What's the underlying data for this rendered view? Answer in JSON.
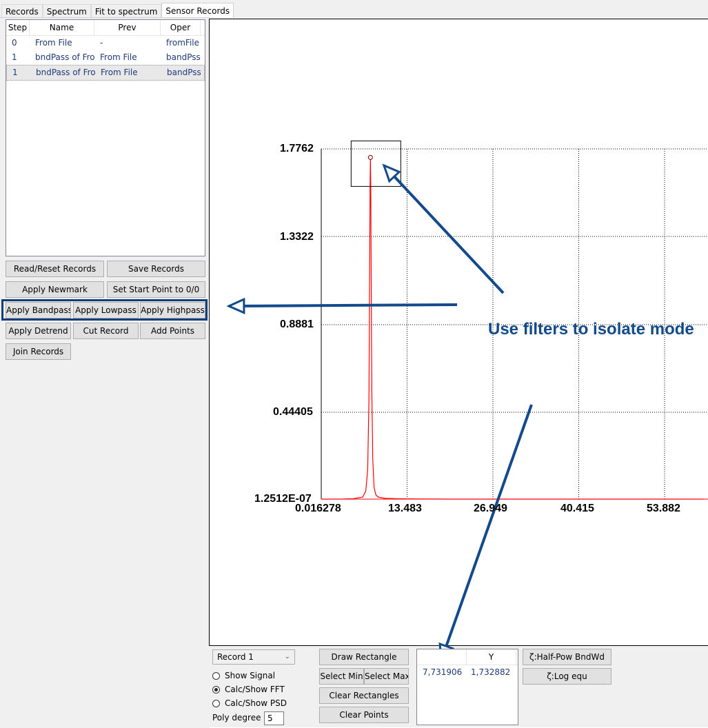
{
  "tabs": [
    "Records",
    "Spectrum",
    "Fit to spectrum",
    "Sensor Records"
  ],
  "records_table": {
    "headers": [
      "Step",
      "Name",
      "Prev",
      "Oper"
    ],
    "rows": [
      {
        "step": "0",
        "name": "From File",
        "prev": "-",
        "oper": "fromFile"
      },
      {
        "step": "1",
        "name": "bndPass of From",
        "prev": "From File",
        "oper": "bandPss"
      },
      {
        "step": "1",
        "name": "bndPass of From",
        "prev": "From File",
        "oper": "bandPss"
      }
    ]
  },
  "buttons": {
    "read_reset": "Read/Reset Records",
    "save": "Save Records",
    "newmark": "Apply Newmark",
    "start_point": "Set Start Point to 0/0",
    "bandpass": "Apply Bandpass",
    "lowpass": "Apply Lowpass",
    "highpass": "Apply Highpass",
    "detrend": "Apply Detrend",
    "cut": "Cut Record",
    "add_points": "Add Points",
    "join": "Join Records",
    "draw_rect": "Draw Rectangle",
    "select_min": "Select Min",
    "select_max": "Select Max",
    "clear_rects": "Clear Rectangles",
    "clear_points": "Clear Points",
    "half_pow": "ζ:Half-Pow BndWd",
    "log_equ": "ζ:Log equ"
  },
  "chart_data": {
    "type": "line",
    "y_ticks": [
      "1.7762",
      "1.3322",
      "0.8881",
      "0.44405",
      "1.2512E-07"
    ],
    "x_ticks": [
      "0.016278",
      "13.483",
      "26.949",
      "40.415",
      "53.882"
    ],
    "ylim": [
      1.2512e-07,
      1.7762
    ],
    "xlim": [
      0.016278,
      53.882
    ],
    "grid": true,
    "line_color": "#ff0000",
    "peak": {
      "x": 7.731906,
      "y": 1.732882
    },
    "series": [
      {
        "values": [
          [
            0.016,
            0.0
          ],
          [
            3.0,
            0.0
          ],
          [
            5.0,
            0.002
          ],
          [
            6.5,
            0.01
          ],
          [
            7.0,
            0.04
          ],
          [
            7.3,
            0.15
          ],
          [
            7.5,
            0.5
          ],
          [
            7.6,
            1.1
          ],
          [
            7.68,
            1.6
          ],
          [
            7.73,
            1.7329
          ],
          [
            7.78,
            1.6
          ],
          [
            7.86,
            1.1
          ],
          [
            7.95,
            0.55
          ],
          [
            8.1,
            0.2
          ],
          [
            8.3,
            0.06
          ],
          [
            8.6,
            0.02
          ],
          [
            9.0,
            0.01
          ],
          [
            10.0,
            0.004
          ],
          [
            12.0,
            0.002
          ],
          [
            15.0,
            0.001
          ],
          [
            20.0,
            0.0
          ],
          [
            60.0,
            0.0
          ]
        ]
      }
    ]
  },
  "annotation": "Use filters to isolate mode",
  "bottom": {
    "record_select": "Record 1",
    "radios": [
      {
        "label": "Show Signal",
        "checked": false
      },
      {
        "label": "Calc/Show FFT",
        "checked": true
      },
      {
        "label": "Calc/Show PSD",
        "checked": false
      }
    ],
    "poly_label": "Poly degree",
    "poly_value": "5"
  },
  "points_grid": {
    "headers": [
      "",
      "Y"
    ],
    "rows": [
      {
        "x": "7,731906",
        "y": "1,732882"
      }
    ]
  },
  "colors": {
    "accent": "#124a8c",
    "signal": "#ff0000"
  }
}
